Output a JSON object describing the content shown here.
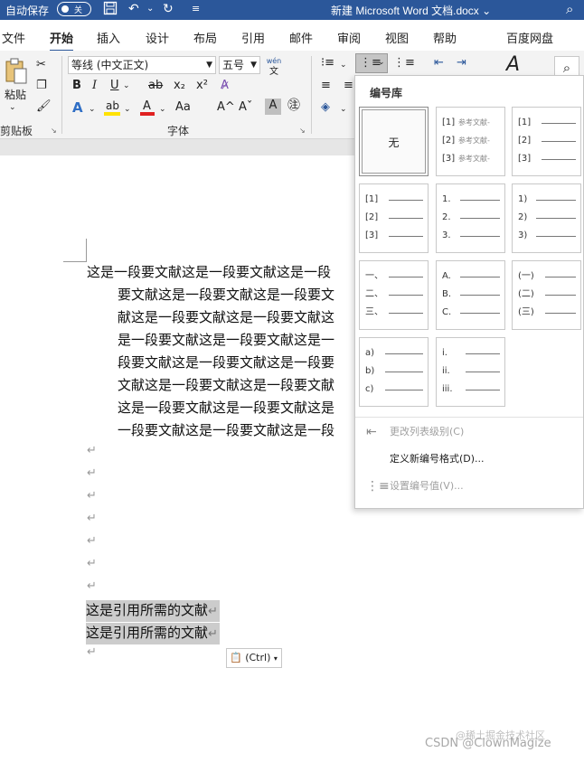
{
  "titlebar": {
    "autosave_label": "自动保存",
    "toggle_state": "关",
    "document_title": "新建 Microsoft Word 文档.docx",
    "title_arrow": "⌄"
  },
  "tabs": [
    {
      "label": "文件"
    },
    {
      "label": "开始"
    },
    {
      "label": "插入"
    },
    {
      "label": "设计"
    },
    {
      "label": "布局"
    },
    {
      "label": "引用"
    },
    {
      "label": "邮件"
    },
    {
      "label": "审阅"
    },
    {
      "label": "视图"
    },
    {
      "label": "帮助"
    },
    {
      "label": "百度网盘"
    }
  ],
  "ribbon": {
    "paste_label": "粘贴",
    "clipboard_group": "剪贴板",
    "font_name": "等线 (中文正文)",
    "font_size": "五号",
    "phonetic_top": "wén",
    "phonetic_bottom": "文",
    "font_group": "字体",
    "bold": "B",
    "italic": "I",
    "underline": "U",
    "strike": "ab",
    "subscript": "x₂",
    "superscript": "x²",
    "font_color_glyph": "A",
    "highlight_glyph": "ab",
    "case_glyph": "Aa",
    "grow_glyph": "A^",
    "shrink_glyph": "Aˇ",
    "shade_glyph": "A",
    "colors": {
      "font_red": "#e02020",
      "highlight_yellow": "#ffe200",
      "accent": "#2b579a"
    }
  },
  "numbering_menu": {
    "library_title": "编号库",
    "none_label": "无",
    "tiles": [
      {
        "rows": [
          {
            "num": "[1]",
            "text": "参考文献-"
          },
          {
            "num": "[2]",
            "text": "参考文献-"
          },
          {
            "num": "[3]",
            "text": "参考文献-"
          }
        ]
      },
      {
        "rows": [
          {
            "num": "[1]"
          },
          {
            "num": "[2]"
          },
          {
            "num": "[3]"
          }
        ]
      },
      {
        "rows": [
          {
            "num": "[1]"
          },
          {
            "num": "[2]"
          },
          {
            "num": "[3]"
          }
        ]
      },
      {
        "rows": [
          {
            "num": "1."
          },
          {
            "num": "2."
          },
          {
            "num": "3."
          }
        ]
      },
      {
        "rows": [
          {
            "num": "1)"
          },
          {
            "num": "2)"
          },
          {
            "num": "3)"
          }
        ]
      },
      {
        "rows": [
          {
            "num": "一、"
          },
          {
            "num": "二、"
          },
          {
            "num": "三、"
          }
        ]
      },
      {
        "rows": [
          {
            "num": "A."
          },
          {
            "num": "B."
          },
          {
            "num": "C."
          }
        ]
      },
      {
        "rows": [
          {
            "num": "(一)"
          },
          {
            "num": "(二)"
          },
          {
            "num": "(三)"
          }
        ]
      },
      {
        "rows": [
          {
            "num": "a)"
          },
          {
            "num": "b)"
          },
          {
            "num": "c)"
          }
        ]
      },
      {
        "rows": [
          {
            "num": "i."
          },
          {
            "num": "ii."
          },
          {
            "num": "iii."
          }
        ]
      }
    ],
    "items": [
      {
        "label": "更改列表级别(C)",
        "disabled": true
      },
      {
        "label": "定义新编号格式(D)...",
        "disabled": false
      },
      {
        "label": "设置编号值(V)...",
        "disabled": true
      }
    ]
  },
  "document": {
    "paragraph_lines": [
      "这是一段要文献这是一段要文献这是一段",
      "要文献这是一段要文献这是一段要文",
      "献这是一段要文献这是一段要文献这",
      "是一段要文献这是一段要文献这是一",
      "段要文献这是一段要文献这是一段要",
      "文献这是一段要文献这是一段要文献",
      "这是一段要文献这是一段要文献这是",
      "一段要文献这是一段要文献这是一段"
    ],
    "empty_paragraph_mark": "↵",
    "references": [
      "这是引用所需的文献",
      "这是引用所需的文献"
    ],
    "paste_options_label": "(Ctrl)",
    "watermark": "CSDN @ClownMagize",
    "watermark_small": "@稀土掘金技术社区"
  }
}
